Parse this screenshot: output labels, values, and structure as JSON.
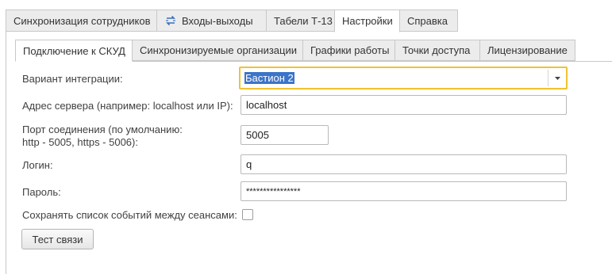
{
  "top_tabs": [
    {
      "label": "Синхронизация сотрудников",
      "active": false
    },
    {
      "label": "Входы-выходы",
      "active": false,
      "icon": "sync-arrows-icon"
    },
    {
      "label": "Табели Т-13",
      "active": false
    },
    {
      "label": "Настройки",
      "active": true
    },
    {
      "label": "Справка",
      "active": false
    }
  ],
  "sub_tabs": [
    {
      "label": "Подключение к СКУД",
      "active": true
    },
    {
      "label": "Синхронизируемые организации",
      "active": false
    },
    {
      "label": "Графики работы",
      "active": false
    },
    {
      "label": "Точки доступа",
      "active": false
    },
    {
      "label": "Лицензирование",
      "active": false
    }
  ],
  "form": {
    "integration_label": "Вариант интеграции:",
    "integration_value": "Бастион 2",
    "server_label": "Адрес сервера (например: localhost или IP):",
    "server_value": "localhost",
    "port_label_line1": "Порт соединения (по умолчанию:",
    "port_label_line2": "http - 5005, https - 5006):",
    "port_value": "5005",
    "login_label": "Логин:",
    "login_value": "q",
    "password_label": "Пароль:",
    "password_value": "****************",
    "save_events_label": "Сохранять список событий между сеансами:",
    "save_events_checked": false,
    "test_button": "Тест связи"
  },
  "colors": {
    "focus_border": "#f2c230",
    "selection": "#3b74c9",
    "tab_inactive": "#ececec",
    "border": "#c8c8c8"
  }
}
